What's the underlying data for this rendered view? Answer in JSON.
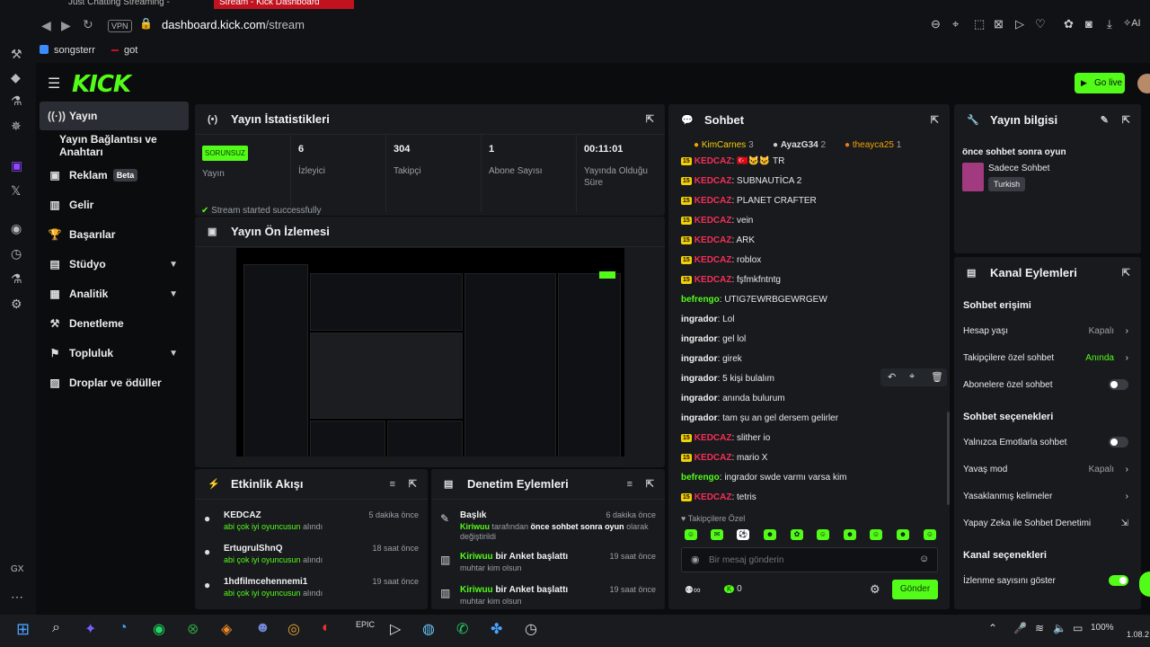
{
  "browser": {
    "tabs": [
      "Just Chatting Streaming -",
      "Stream - Kick Dashboard"
    ],
    "vpn_label": "VPN",
    "url_domain": "dashboard.kick.com",
    "url_path": "/stream",
    "bookmarks": [
      "songsterr",
      "got"
    ],
    "ai_label": "AI"
  },
  "header": {
    "logo": "KICK",
    "go_live": "Go live"
  },
  "sidebar": {
    "items": [
      {
        "label": "Yayın",
        "icon": "broadcast-icon"
      },
      {
        "label": "Yayın Bağlantısı ve Anahtarı",
        "icon": ""
      },
      {
        "label": "Reklam",
        "icon": "ad-icon",
        "badge": "Beta"
      },
      {
        "label": "Gelir",
        "icon": "revenue-icon"
      },
      {
        "label": "Başarılar",
        "icon": "trophy-icon"
      },
      {
        "label": "Stüdyo",
        "icon": "studio-icon"
      },
      {
        "label": "Analitik",
        "icon": "analytics-icon"
      },
      {
        "label": "Denetleme",
        "icon": "moderation-icon"
      },
      {
        "label": "Topluluk",
        "icon": "community-icon"
      },
      {
        "label": "Droplar ve ödüller",
        "icon": "drops-icon"
      }
    ]
  },
  "stats": {
    "title": "Yayın İstatistikleri",
    "status_badge": "SORUNSUZ",
    "status_label": "Yayın",
    "viewers": "6",
    "viewers_label": "İzleyici",
    "followers": "304",
    "followers_label": "Takipçi",
    "subs": "1",
    "subs_label": "Abone Sayısı",
    "uptime": "00:11:01",
    "uptime_label": "Yayında Olduğu Süre",
    "toast": "Stream started successfully"
  },
  "preview": {
    "title": "Yayın Ön İzlemesi"
  },
  "activity": {
    "title": "Etkinlik Akışı",
    "items": [
      {
        "user": "KEDCAZ",
        "time": "5 dakika önce",
        "reward": "abi çok iyi oyuncusun",
        "suffix": " alındı"
      },
      {
        "user": "ErtugrulShnQ",
        "time": "18 saat önce",
        "reward": "abi çok iyi oyuncusun",
        "suffix": " alındı"
      },
      {
        "user": "1hdfilmcehennemi1",
        "time": "19 saat önce",
        "reward": "abi çok iyi oyuncusun",
        "suffix": " alındı"
      }
    ]
  },
  "modlog": {
    "title": "Denetim Eylemleri",
    "items": [
      {
        "title": "Başlık",
        "time": "6 dakika önce",
        "actor": "Kiriwuu",
        "detail": " tarafından ",
        "bold": "önce sohbet sonra oyun",
        "end": " olarak değiştirildi"
      },
      {
        "actor": "Kiriwuu",
        "action": " bir Anket başlattı",
        "time": "19 saat önce",
        "detail": "muhtar kim olsun"
      },
      {
        "actor": "Kiriwuu",
        "action": " bir Anket başlattı",
        "time": "19 saat önce",
        "detail": "muhtar kim olsun"
      }
    ]
  },
  "chat": {
    "title": "Sohbet",
    "gifters": [
      {
        "name": "KimCarnes",
        "count": "3"
      },
      {
        "name": "AyazG34",
        "count": "2"
      },
      {
        "name": "theayca25",
        "count": "1"
      }
    ],
    "messages": [
      {
        "sub": "15",
        "user": "KEDCAZ",
        "color": "red",
        "text": ": 🇹🇷🐱🐱 TR"
      },
      {
        "sub": "15",
        "user": "KEDCAZ",
        "color": "red",
        "text": ": SUBNAUTİCA 2"
      },
      {
        "sub": "15",
        "user": "KEDCAZ",
        "color": "red",
        "text": ": PLANET CRAFTER"
      },
      {
        "sub": "15",
        "user": "KEDCAZ",
        "color": "red",
        "text": ": vein"
      },
      {
        "sub": "15",
        "user": "KEDCAZ",
        "color": "red",
        "text": ": ARK"
      },
      {
        "sub": "15",
        "user": "KEDCAZ",
        "color": "red",
        "text": ": roblox"
      },
      {
        "sub": "15",
        "user": "KEDCAZ",
        "color": "red",
        "text": ": fşfmkfntntg"
      },
      {
        "sub": "",
        "user": "befrengo",
        "color": "grn",
        "text": ": UTIG7EWRBGEWRGEW"
      },
      {
        "sub": "",
        "user": "ingrador",
        "color": "wht",
        "text": ": Lol"
      },
      {
        "sub": "",
        "user": "ingrador",
        "color": "wht",
        "text": ": gel lol"
      },
      {
        "sub": "",
        "user": "ingrador",
        "color": "wht",
        "text": ": girek"
      },
      {
        "sub": "",
        "user": "ingrador",
        "color": "wht",
        "text": ": 5 kişi bulalım"
      },
      {
        "sub": "",
        "user": "ingrador",
        "color": "wht",
        "text": ": anında bulurum"
      },
      {
        "sub": "",
        "user": "ingrador",
        "color": "wht",
        "text": ": tam şu an gel dersem gelirler"
      },
      {
        "sub": "15",
        "user": "KEDCAZ",
        "color": "red",
        "text": ": slither io"
      },
      {
        "sub": "15",
        "user": "KEDCAZ",
        "color": "red",
        "text": ": mario X"
      },
      {
        "sub": "",
        "user": "befrengo",
        "color": "grn",
        "text": ": ingrador swde varmı varsa kim"
      },
      {
        "sub": "15",
        "user": "KEDCAZ",
        "color": "red",
        "text": ": tetris"
      }
    ],
    "followers_only": "Takipçilere Özel",
    "placeholder": "Bir mesaj gönderin",
    "points": "0",
    "send": "Gönder"
  },
  "info": {
    "title": "Yayın bilgisi",
    "stream_title": "önce sohbet sonra oyun",
    "category": "Sadece Sohbet",
    "language": "Turkish"
  },
  "channel_actions": {
    "title": "Kanal Eylemleri",
    "chat_access": "Sohbet erişimi",
    "account_age": "Hesap yaşı",
    "account_age_val": "Kapalı",
    "followers_chat": "Takipçilere özel sohbet",
    "followers_chat_val": "Anında",
    "subs_chat": "Abonelere özel sohbet",
    "chat_options": "Sohbet seçenekleri",
    "emote_only": "Yalnızca Emotlarla sohbet",
    "slow_mode": "Yavaş mod",
    "slow_mode_val": "Kapalı",
    "banned_words": "Yasaklanmış kelimeler",
    "ai_mod": "Yapay Zeka ile Sohbet Denetimi",
    "channel_options": "Kanal seçenekleri",
    "show_views": "İzlenme sayısını göster"
  },
  "taskbar": {
    "battery": "100%",
    "date": "1.08.2"
  },
  "colors": {
    "accent": "#53fc18",
    "chat_red": "#f52f57",
    "panel": "#181a1e",
    "background": "#0b0c0e"
  }
}
